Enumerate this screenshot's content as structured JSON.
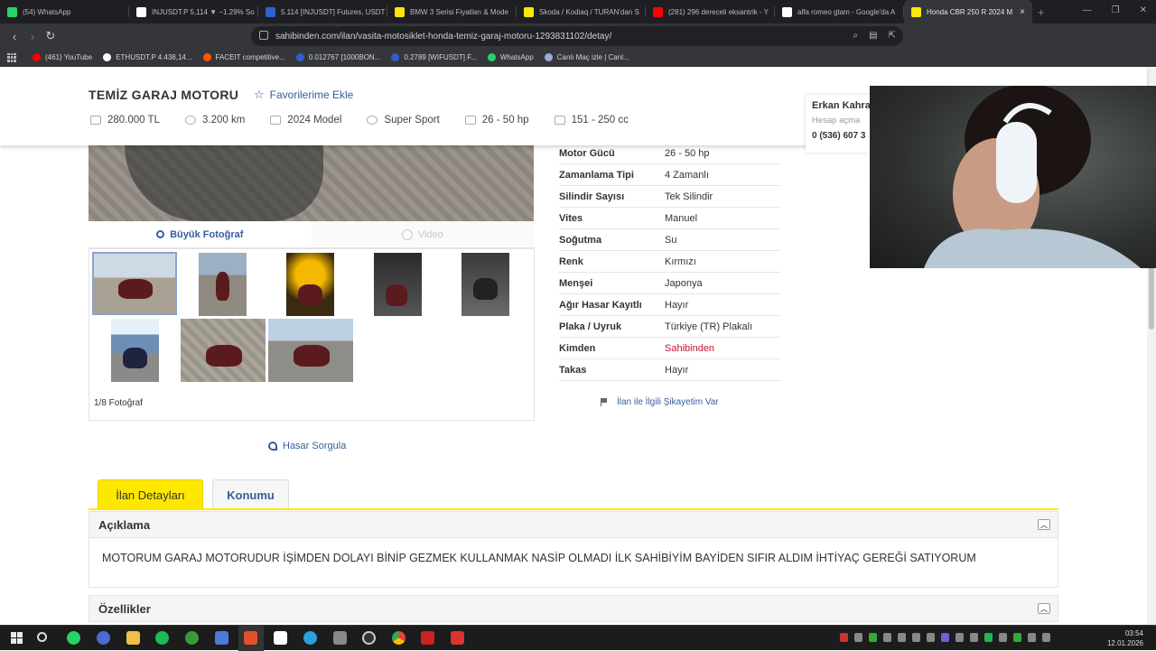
{
  "browser": {
    "tabs": [
      {
        "title": "(54) WhatsApp",
        "color": "#25d366"
      },
      {
        "title": "INJUSDT.P 5,114 ▼ −1.29% So",
        "color": "#ffffff"
      },
      {
        "title": "5.114 [INJUSDT] Futures, USDT",
        "color": "#2f5fd0"
      },
      {
        "title": "BMW 3 Serisi Fiyatları & Mode",
        "color": "#ffe800"
      },
      {
        "title": "Skoda / Kodiaq / TURAN'dan S",
        "color": "#ffe800"
      },
      {
        "title": "(281) 296 dereceli eksantrik - Y",
        "color": "#ff0000"
      },
      {
        "title": "alfa romeo gtam - Google'da A",
        "color": "#ffffff"
      },
      {
        "title": "Honda CBR 250 R 2024 M",
        "color": "#ffe800"
      }
    ],
    "active_tab_close": "×",
    "new_tab": "+",
    "url": "sahibinden.com/ilan/vasita-motosiklet-honda-temiz-garaj-motoru-1293831102/detay/",
    "bookmarks": [
      {
        "label": "(461) YouTube",
        "color": "#ff0000"
      },
      {
        "label": "ETHUSDT.P 4.438,14...",
        "color": "#ffffff"
      },
      {
        "label": "FACEIT competitive...",
        "color": "#ff5500"
      },
      {
        "label": "0.012767 [1000BON...",
        "color": "#2f5fd0"
      },
      {
        "label": "0.2789 [WIFUSDT] F...",
        "color": "#2f5fd0"
      },
      {
        "label": "WhatsApp",
        "color": "#25d366"
      },
      {
        "label": "Canlı Maç izle | Canl...",
        "color": "#9ad"
      }
    ]
  },
  "listing": {
    "title": "TEMİZ GARAJ MOTORU",
    "favorite_label": "Favorilerime Ekle",
    "specs": [
      "280.000 TL",
      "3.200 km",
      "2024 Model",
      "Super Sport",
      "26 - 50 hp",
      "151 - 250 cc"
    ],
    "gallery": {
      "big_photo_label": "Büyük Fotoğraf",
      "video_label": "Video",
      "photo_count": "1/8 Fotoğraf"
    },
    "damage_query": "Hasar Sorgula",
    "details": [
      {
        "k": "Motor Gücü",
        "v": "26 - 50 hp"
      },
      {
        "k": "Zamanlama Tipi",
        "v": "4 Zamanlı"
      },
      {
        "k": "Silindir Sayısı",
        "v": "Tek Silindir"
      },
      {
        "k": "Vites",
        "v": "Manuel"
      },
      {
        "k": "Soğutma",
        "v": "Su"
      },
      {
        "k": "Renk",
        "v": "Kırmızı"
      },
      {
        "k": "Menşei",
        "v": "Japonya"
      },
      {
        "k": "Ağır Hasar Kayıtlı",
        "v": "Hayır"
      },
      {
        "k": "Plaka / Uyruk",
        "v": "Türkiye (TR) Plakalı"
      },
      {
        "k": "Kimden",
        "v": "Sahibinden"
      },
      {
        "k": "Takas",
        "v": "Hayır"
      }
    ],
    "complaint": "İlan ile İlgili Şikayetim Var",
    "tabs": {
      "details": "İlan Detayları",
      "location": "Konumu"
    },
    "description_title": "Açıklama",
    "description": "MOTORUM GARAJ MOTORUDUR İŞİMDEN DOLAYI BİNİP GEZMEK KULLANMAK NASİP OLMADI İLK SAHİBİYİM BAYİDEN SIFIR ALDIM İHTİYAÇ GEREĞİ SATIYORUM",
    "features_title": "Özellikler",
    "collapse_glyph": "︿"
  },
  "seller": {
    "name": "Erkan Kahra",
    "subtitle": "Hesap açma",
    "phone": "0 (536) 607 3"
  },
  "taskbar": {
    "time": "03:54",
    "date": "12.01.2026"
  }
}
